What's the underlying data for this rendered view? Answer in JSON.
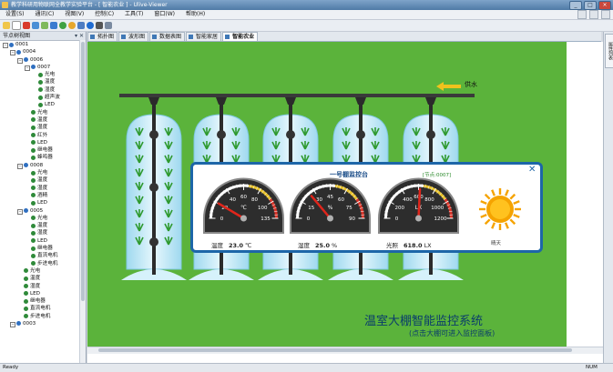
{
  "window": {
    "title": "教学科研用物联网全教学实验平台 - [ 智能农业 ] - Ulive-Viewer"
  },
  "menu": [
    "设置(S)",
    "通讯(C)",
    "视图(V)",
    "控制(C)",
    "工具(T)",
    "窗口(W)",
    "帮助(H)"
  ],
  "tree": {
    "header": "节点树视图",
    "items": [
      {
        "label": "0001",
        "level": 0,
        "kind": "root"
      },
      {
        "label": "0004",
        "level": 1,
        "kind": "node"
      },
      {
        "label": "0006",
        "level": 2,
        "kind": "node"
      },
      {
        "label": "0007",
        "level": 3,
        "kind": "node"
      },
      {
        "label": "光电",
        "level": 4,
        "kind": "sensor"
      },
      {
        "label": "温度",
        "level": 4,
        "kind": "sensor"
      },
      {
        "label": "湿度",
        "level": 4,
        "kind": "sensor"
      },
      {
        "label": "超声波",
        "level": 4,
        "kind": "sensor"
      },
      {
        "label": "LED",
        "level": 4,
        "kind": "sensor"
      },
      {
        "label": "光电",
        "level": 3,
        "kind": "sensor"
      },
      {
        "label": "温度",
        "level": 3,
        "kind": "sensor"
      },
      {
        "label": "湿度",
        "level": 3,
        "kind": "sensor"
      },
      {
        "label": "红外",
        "level": 3,
        "kind": "sensor"
      },
      {
        "label": "LED",
        "level": 3,
        "kind": "sensor"
      },
      {
        "label": "继电器",
        "level": 3,
        "kind": "sensor"
      },
      {
        "label": "蜂鸣器",
        "level": 3,
        "kind": "sensor"
      },
      {
        "label": "0008",
        "level": 2,
        "kind": "node"
      },
      {
        "label": "光电",
        "level": 3,
        "kind": "sensor"
      },
      {
        "label": "温度",
        "level": 3,
        "kind": "sensor"
      },
      {
        "label": "湿度",
        "level": 3,
        "kind": "sensor"
      },
      {
        "label": "酒精",
        "level": 3,
        "kind": "sensor"
      },
      {
        "label": "LED",
        "level": 3,
        "kind": "sensor"
      },
      {
        "label": "0005",
        "level": 2,
        "kind": "node"
      },
      {
        "label": "光电",
        "level": 3,
        "kind": "sensor"
      },
      {
        "label": "温度",
        "level": 3,
        "kind": "sensor"
      },
      {
        "label": "湿度",
        "level": 3,
        "kind": "sensor"
      },
      {
        "label": "LED",
        "level": 3,
        "kind": "sensor"
      },
      {
        "label": "继电器",
        "level": 3,
        "kind": "sensor"
      },
      {
        "label": "直流电机",
        "level": 3,
        "kind": "sensor"
      },
      {
        "label": "步进电机",
        "level": 3,
        "kind": "sensor"
      },
      {
        "label": "光电",
        "level": 2,
        "kind": "sensor"
      },
      {
        "label": "温度",
        "level": 2,
        "kind": "sensor"
      },
      {
        "label": "湿度",
        "level": 2,
        "kind": "sensor"
      },
      {
        "label": "LED",
        "level": 2,
        "kind": "sensor"
      },
      {
        "label": "继电器",
        "level": 2,
        "kind": "sensor"
      },
      {
        "label": "直流电机",
        "level": 2,
        "kind": "sensor"
      },
      {
        "label": "步进电机",
        "level": 2,
        "kind": "sensor"
      },
      {
        "label": "0003",
        "level": 1,
        "kind": "node"
      }
    ]
  },
  "tabs": [
    {
      "label": "拓扑图",
      "active": false
    },
    {
      "label": "波形图",
      "active": false
    },
    {
      "label": "数据表图",
      "active": false
    },
    {
      "label": "智能家居",
      "active": false
    },
    {
      "label": "智能农业",
      "active": true
    }
  ],
  "right_panel_label": "属性列表",
  "canvas": {
    "flow_label": "供水",
    "main_title": "温室大棚智能监控系统",
    "subtitle": "(点击大棚可进入监控面板)"
  },
  "control_panel": {
    "title": "一号棚监控台",
    "subtitle": "[节点:0007]",
    "close": "✕",
    "gauges": [
      {
        "label": "温度",
        "value": "23.0",
        "unit": "℃",
        "min": 0,
        "max": 135,
        "ticks": [
          "0",
          "20",
          "40",
          "60",
          "80",
          "100",
          "135"
        ],
        "needle_value": 23,
        "center_label": "℃"
      },
      {
        "label": "湿度",
        "value": "25.0",
        "unit": "%",
        "min": 0,
        "max": 90,
        "ticks": [
          "0",
          "15",
          "30",
          "45",
          "60",
          "75",
          "90"
        ],
        "needle_value": 25,
        "center_label": "%"
      },
      {
        "label": "光照",
        "value": "618.0",
        "unit": "LX",
        "min": 0,
        "max": 1200,
        "ticks": [
          "0",
          "200",
          "400",
          "600",
          "800",
          "1000",
          "1200"
        ],
        "needle_value": 618,
        "center_label": "LX"
      }
    ],
    "weather_label": "晴天"
  },
  "status": {
    "left": "Ready",
    "right": "NUM"
  },
  "colors": {
    "canvas_green": "#5bb33b",
    "panel_border": "#1d66a8",
    "sun": "#f5a300",
    "greenhouse": "#bfe8f5"
  }
}
